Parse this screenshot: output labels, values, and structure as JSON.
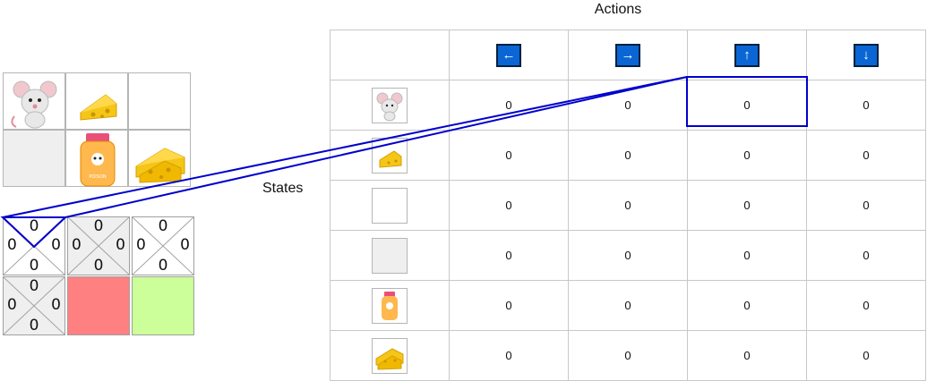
{
  "labels": {
    "actions": "Actions",
    "states": "States",
    "poison_text": "POISON"
  },
  "actions": [
    {
      "symbol": "←",
      "icon": "arrow-left-icon"
    },
    {
      "symbol": "→",
      "icon": "arrow-right-icon"
    },
    {
      "symbol": "↑",
      "icon": "arrow-up-icon"
    },
    {
      "symbol": "↓",
      "icon": "arrow-down-icon"
    }
  ],
  "grid_world": [
    [
      "mouse",
      "cheese",
      "empty"
    ],
    [
      "empty-gray",
      "poison",
      "big-cheese"
    ]
  ],
  "q_grid": {
    "cells": [
      {
        "n": "0",
        "w": "0",
        "e": "0",
        "s": "0",
        "fill": "#ffffff"
      },
      {
        "n": "0",
        "w": "0",
        "e": "0",
        "s": "0",
        "fill": "#efefef"
      },
      {
        "n": "0",
        "w": "0",
        "e": "0",
        "s": "0",
        "fill": "#ffffff"
      },
      {
        "n": "0",
        "w": "0",
        "e": "0",
        "s": "0",
        "fill": "#efefef"
      },
      {
        "n": "",
        "w": "",
        "e": "",
        "s": "",
        "fill": "#ff8080"
      },
      {
        "n": "",
        "w": "",
        "e": "",
        "s": "",
        "fill": "#ccff99"
      }
    ]
  },
  "q_table": {
    "rows": [
      {
        "state": "mouse",
        "values": [
          "0",
          "0",
          "0",
          "0"
        ]
      },
      {
        "state": "cheese",
        "values": [
          "0",
          "0",
          "0",
          "0"
        ]
      },
      {
        "state": "empty",
        "values": [
          "0",
          "0",
          "0",
          "0"
        ]
      },
      {
        "state": "empty-gray",
        "values": [
          "0",
          "0",
          "0",
          "0"
        ]
      },
      {
        "state": "poison",
        "values": [
          "0",
          "0",
          "0",
          "0"
        ]
      },
      {
        "state": "big-cheese",
        "values": [
          "0",
          "0",
          "0",
          "0"
        ]
      }
    ]
  },
  "colors": {
    "highlight": "#0000cc",
    "action_icon": "#0a66d4",
    "poison_cell": "#ff8080",
    "goal_cell": "#ccff99"
  }
}
